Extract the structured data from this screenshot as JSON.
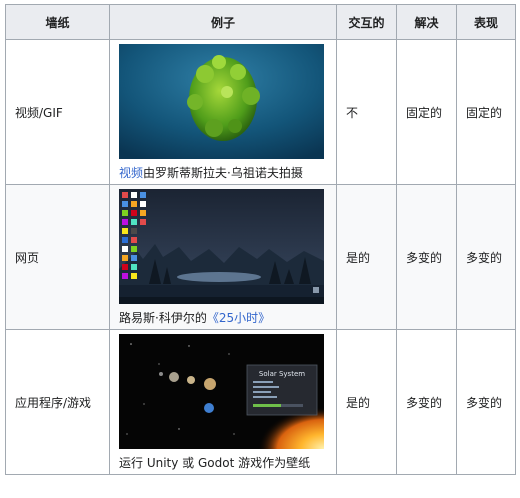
{
  "table": {
    "headers": [
      "墙纸",
      "例子",
      "交互的",
      "解决",
      "表现"
    ],
    "rows": [
      {
        "wallpaper": "视频/GIF",
        "caption_link": "视频",
        "caption_text": "由罗斯蒂斯拉夫·乌祖诺夫拍摄",
        "interactive": "不",
        "resolution": "固定的",
        "performance": "固定的"
      },
      {
        "wallpaper": "网页",
        "caption_text": "路易斯·科伊尔的",
        "caption_link": "《25小时》",
        "interactive": "是的",
        "resolution": "多变的",
        "performance": "多变的"
      },
      {
        "wallpaper": "应用程序/游戏",
        "caption_text": "运行 Unity 或 Godot 游戏作为壁纸",
        "interactive": "是的",
        "resolution": "多变的",
        "performance": "多变的",
        "thumb_panel_title": "Solar System"
      }
    ]
  },
  "colors": {
    "header_bg": "#eaecf0",
    "border": "#a2a9b1",
    "link": "#3366cc",
    "alt_row_bg": "#f8f9fa"
  }
}
